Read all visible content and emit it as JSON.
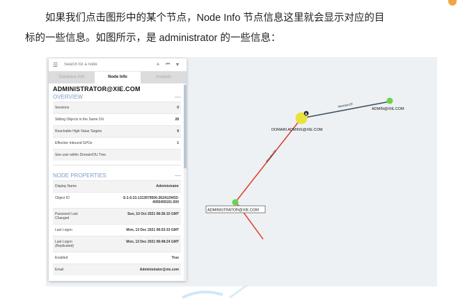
{
  "article": {
    "line1": "如果我们点击图形中的某个节点，Node Info 节点信息这里就会显示对应的目",
    "line2": "标的一些信息。如图所示，是 administrator 的一些信息："
  },
  "panel": {
    "search_placeholder": "Search for a node",
    "tabs": [
      "Database Info",
      "Node Info",
      "Analysis"
    ],
    "active_tab": "Node Info",
    "node_title": "ADMINISTRATOR@XIE.COM",
    "overview": {
      "title": "OVERVIEW",
      "rows": [
        {
          "label": "Sessions",
          "value": "0"
        },
        {
          "label": "Sibling Objects in the Same OU",
          "value": "28"
        },
        {
          "label": "Reachable High Value Targets",
          "value": "9"
        },
        {
          "label": "Effective Inbound GPOs",
          "value": "1"
        },
        {
          "label": "See user within Domain/OU Tree",
          "value": ""
        }
      ]
    },
    "properties": {
      "title": "NODE PROPERTIES",
      "rows": [
        {
          "label": "Display Name",
          "value": "Administrator"
        },
        {
          "label": "Object ID",
          "value": "S-1-5-21-1313979556-3624129433-4055459191-500"
        },
        {
          "label": "Password Last Changed",
          "value": "Sun, 10 Oct 2021 08:36:15 GMT"
        },
        {
          "label": "Last Logon",
          "value": "Mon, 13 Dec 2021 08:53:33 GMT"
        },
        {
          "label": "Last Logon (Replicated)",
          "value": "Mon, 13 Dec 2021 08:48:24 GMT"
        },
        {
          "label": "Enabled",
          "value": "True"
        },
        {
          "label": "Email",
          "value": "Administrator@xie.com"
        }
      ]
    }
  },
  "graph": {
    "nodes": {
      "admin_user": "ADMINISTRATOR@XIE.COM",
      "domain_admins": "DOMAIN ADMINS@XIE.COM",
      "admin_xie": "ADMIN@XIE.COM"
    },
    "edges": {
      "member_of_1": "MemberOf",
      "member_of_2": "MemberOf"
    },
    "colors": {
      "user_node": "#6ad34d",
      "group_node": "#e8e33d",
      "edge_highlight": "#e0442f",
      "edge_normal": "#3d4f5e"
    }
  }
}
